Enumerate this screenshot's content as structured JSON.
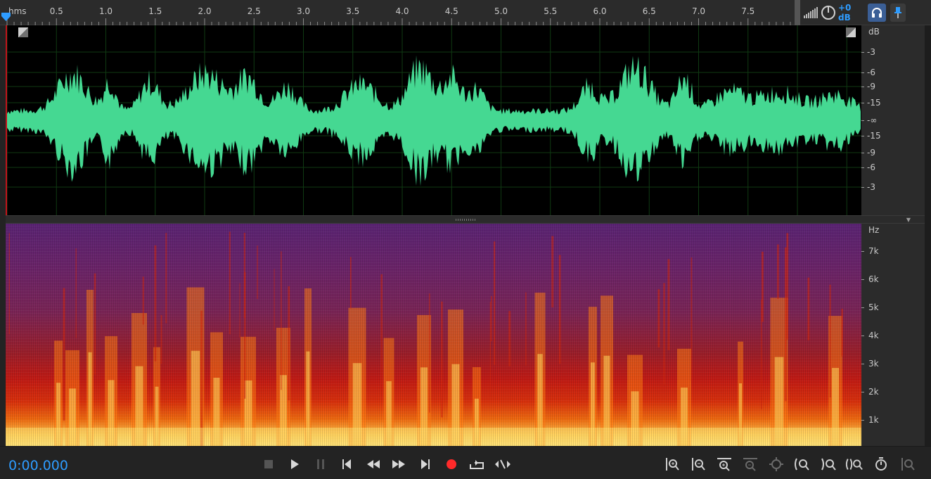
{
  "ruler": {
    "unit_label": "hms",
    "ticks": [
      "0.5",
      "1.0",
      "1.5",
      "2.0",
      "2.5",
      "3.0",
      "3.5",
      "4.0",
      "4.5",
      "5.0",
      "5.5",
      "6.0",
      "6.5",
      "7.0",
      "7.5"
    ]
  },
  "controls": {
    "volume_value": "+0 dB",
    "meter_icon": "level-meter-icon",
    "knob_icon": "volume-knob-icon",
    "headphones_icon": "headphones-icon",
    "pin_icon": "pin-icon"
  },
  "waveform": {
    "scale_unit": "dB",
    "scale_labels": [
      "-3",
      "-6",
      "-9",
      "-15",
      "-∞",
      "-15",
      "-9",
      "-6",
      "-3"
    ],
    "color": "#45d892"
  },
  "spectral": {
    "scale_unit": "Hz",
    "scale_labels": [
      "7k",
      "6k",
      "5k",
      "4k",
      "3k",
      "2k",
      "1k"
    ]
  },
  "transport": {
    "time": "0:00.000",
    "buttons": [
      "stop-icon",
      "play-icon",
      "pause-icon",
      "skip-to-start-icon",
      "rewind-icon",
      "fast-forward-icon",
      "skip-to-end-icon",
      "record-icon",
      "loop-icon",
      "skip-selection-icon"
    ],
    "zoom_buttons": [
      "zoom-in-amplitude-icon",
      "zoom-out-amplitude-icon",
      "zoom-in-time-icon",
      "zoom-out-time-icon",
      "zoom-full-icon",
      "zoom-in-left-icon",
      "zoom-in-right-icon",
      "zoom-selection-icon",
      "zoom-time-icon",
      "zoom-reset-icon"
    ],
    "accent": "#2e9cff",
    "record_color": "#ff2a2a"
  }
}
